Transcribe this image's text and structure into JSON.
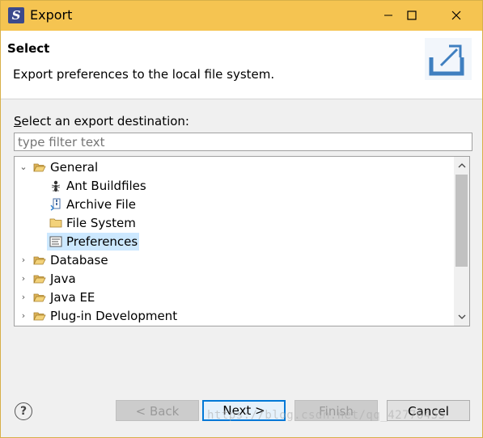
{
  "window": {
    "title": "Export",
    "minimize_glyph": "—",
    "maximize_glyph": "☐",
    "close_glyph": "✕",
    "app_icon": "eclipse-icon"
  },
  "header": {
    "title": "Select",
    "description": "Export preferences to the local file system.",
    "image": "export-wizard-icon"
  },
  "destination": {
    "label_first_letter": "S",
    "label_rest": "elect an export destination:"
  },
  "filter": {
    "placeholder": "type filter text",
    "value": ""
  },
  "tree": {
    "items": [
      {
        "label": "General",
        "expanded": true,
        "icon": "folder-open-icon"
      },
      {
        "label": "Ant Buildfiles",
        "icon": "ant-icon",
        "parent": "General"
      },
      {
        "label": "Archive File",
        "icon": "archive-file-icon",
        "parent": "General"
      },
      {
        "label": "File System",
        "icon": "folder-icon",
        "parent": "General"
      },
      {
        "label": "Preferences",
        "icon": "preferences-icon",
        "parent": "General",
        "selected": true
      },
      {
        "label": "Database",
        "expanded": false,
        "icon": "folder-icon"
      },
      {
        "label": "Java",
        "expanded": false,
        "icon": "folder-icon"
      },
      {
        "label": "Java EE",
        "expanded": false,
        "icon": "folder-icon"
      },
      {
        "label": "Plug-in Development",
        "expanded": false,
        "icon": "folder-icon"
      }
    ]
  },
  "buttons": {
    "help": "?",
    "back": "< Back",
    "next": "Next >",
    "finish": "Finish",
    "cancel": "Cancel"
  },
  "watermark": "https://blog.csdn.net/qq_42776455",
  "colors": {
    "titlebar": "#f5c451",
    "selection": "#cce8ff",
    "default_button_border": "#0078d7"
  }
}
